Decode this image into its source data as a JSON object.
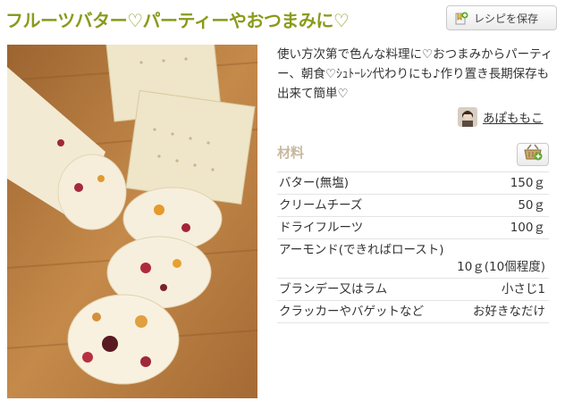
{
  "recipe": {
    "title": "フルーツバター♡パーティーやおつまみに♡",
    "save_label": "レシピを保存",
    "description": "使い方次第で色んな料理に♡おつまみからパーティー、朝食♡ｼｭﾄｰﾚﾝ代わりにも♪作り置き長期保存も出来て簡単♡",
    "author": "あぽももこ"
  },
  "ingredients": {
    "heading": "材料",
    "items": [
      {
        "name": "バター(無塩)",
        "amount": "150ｇ"
      },
      {
        "name": "クリームチーズ",
        "amount": "50ｇ"
      },
      {
        "name": "ドライフルーツ",
        "amount": "100ｇ"
      },
      {
        "name": "アーモンド(できればロースト)",
        "amount": "10ｇ(10個程度)"
      },
      {
        "name": "ブランデー又はラム",
        "amount": "小さじ1"
      },
      {
        "name": "クラッカーやバゲットなど",
        "amount": "お好きなだけ"
      }
    ]
  },
  "icons": {
    "save": "bookmark-plus-icon",
    "cart": "basket-add-icon"
  },
  "colors": {
    "title": "#8a9a1b",
    "heading": "#c8b8a0",
    "add_green": "#5cab2e"
  }
}
